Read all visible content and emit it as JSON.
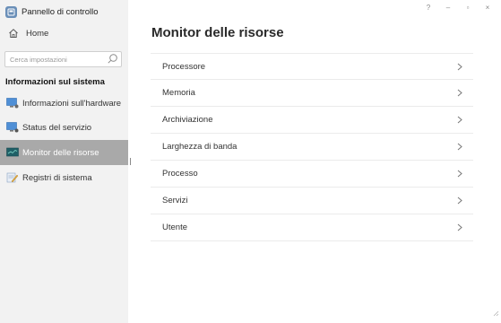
{
  "app": {
    "title": "Pannello di controllo"
  },
  "window_controls": {
    "help": "?",
    "minimize": "–",
    "maximize": "▫",
    "close": "×"
  },
  "sidebar": {
    "home_label": "Home",
    "search": {
      "placeholder": "Cerca impostazioni",
      "value": ""
    },
    "section_title": "Informazioni sul sistema",
    "items": [
      {
        "label": "Informazioni sull'hardware",
        "icon": "monitor-icon",
        "active": false
      },
      {
        "label": "Status del servizio",
        "icon": "service-status-icon",
        "active": false
      },
      {
        "label": "Monitor delle risorse",
        "icon": "resource-monitor-icon",
        "active": true
      },
      {
        "label": "Registri di sistema",
        "icon": "log-icon",
        "active": false
      }
    ]
  },
  "main": {
    "title": "Monitor delle risorse",
    "rows": [
      {
        "label": "Processore"
      },
      {
        "label": "Memoria"
      },
      {
        "label": "Archiviazione"
      },
      {
        "label": "Larghezza di banda"
      },
      {
        "label": "Processo"
      },
      {
        "label": "Servizi"
      },
      {
        "label": "Utente"
      }
    ]
  },
  "colors": {
    "sidebar_bg": "#f2f2f2",
    "active_item_bg": "#a9a9a9",
    "divider": "#ebebeb"
  }
}
